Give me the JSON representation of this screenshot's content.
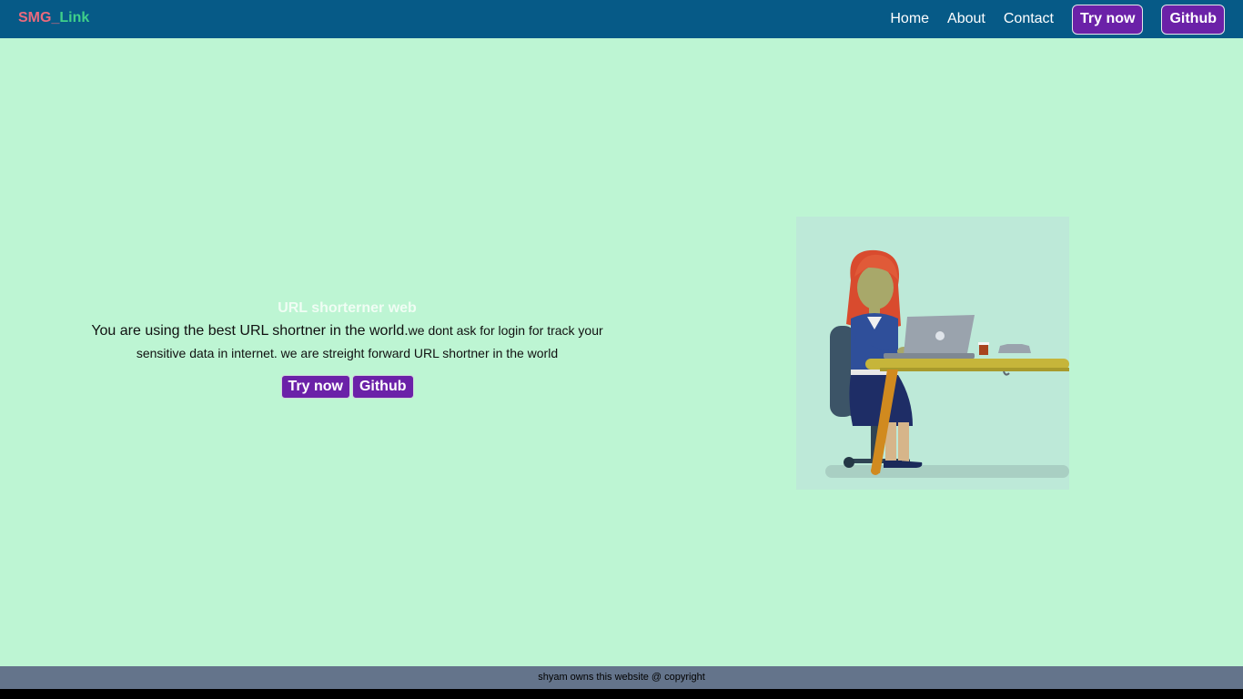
{
  "brand": {
    "part1": "SMG_",
    "part2": "Link",
    "color1": "#e96a7d",
    "color2": "#3fd08a"
  },
  "nav": {
    "links": [
      "Home",
      "About",
      "Contact"
    ],
    "try_now": "Try now",
    "github": "Github"
  },
  "hero": {
    "title": "URL shorterner web",
    "lead": "You are using the best URL shortner in the world.",
    "desc": "we dont ask for login for track your sensitive data in internet. we are streight forward URL shortner in the world",
    "try_now": "Try now",
    "github": "Github"
  },
  "illustration": {
    "icon": "woman-at-laptop-illustration"
  },
  "footer": {
    "text": "shyam owns this website @ copyright"
  },
  "colors": {
    "nav_bg": "#065a87",
    "main_bg": "#bdf5d3",
    "button_bg": "#6b21a8",
    "footer_bg": "#64748b"
  }
}
